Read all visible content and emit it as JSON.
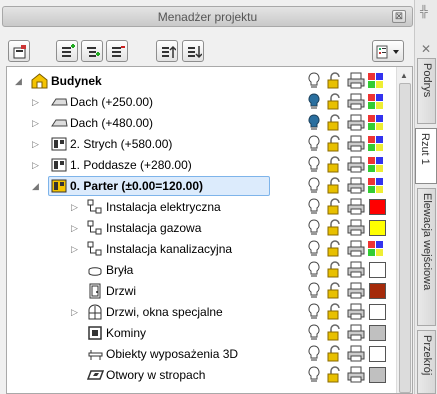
{
  "panel": {
    "title": "Menadżer projektu",
    "close_glyph": "⊠"
  },
  "toolbar": {
    "buttons": [
      "new-item-icon",
      "add-level-icon",
      "add-sublevel-icon",
      "remove-icon",
      "move-up-icon",
      "move-down-icon",
      "filter-dropdown-icon"
    ]
  },
  "tree": {
    "items": [
      {
        "label": "Budynek",
        "bold": true,
        "icon": "building-icon"
      },
      {
        "label": "Dach (+250.00)",
        "icon": "roof-icon"
      },
      {
        "label": "Dach (+480.00)",
        "icon": "roof-icon"
      },
      {
        "label": "2. Strych (+580.00)",
        "icon": "floor-icon"
      },
      {
        "label": "1. Poddasze (+280.00)",
        "icon": "floor-icon"
      },
      {
        "label": "0. Parter (±0.00=120.00)",
        "bold": true,
        "icon": "floor-active-icon"
      },
      {
        "label": "Instalacja elektryczna",
        "icon": "installation-icon",
        "color": "#ff0000"
      },
      {
        "label": "Instalacja gazowa",
        "icon": "installation-icon",
        "color": "#ffff00"
      },
      {
        "label": "Instalacja kanalizacyjna",
        "icon": "installation-icon"
      },
      {
        "label": "Bryła",
        "icon": "solid-icon",
        "color": "#ffffff"
      },
      {
        "label": "Drzwi",
        "icon": "door-icon",
        "color": "#a52a0a"
      },
      {
        "label": "Drzwi, okna specjalne",
        "icon": "special-window-icon",
        "color": "#ffffff"
      },
      {
        "label": "Kominy",
        "icon": "chimney-icon",
        "color": "#c0c0c0"
      },
      {
        "label": "Obiekty wyposażenia 3D",
        "icon": "furniture-icon",
        "color": "#ffffff"
      },
      {
        "label": "Otwory w stropach",
        "icon": "ceiling-opening-icon",
        "color": "#c0c0c0"
      }
    ]
  },
  "side_tabs": [
    "Podrys",
    "Rzut 1",
    "Elewacja wejściowa",
    "Przekrój"
  ],
  "colors": {
    "selection_border": "#7eb4ea",
    "selection_fill": "#dcebfc",
    "building_yellow": "#f5c400"
  }
}
